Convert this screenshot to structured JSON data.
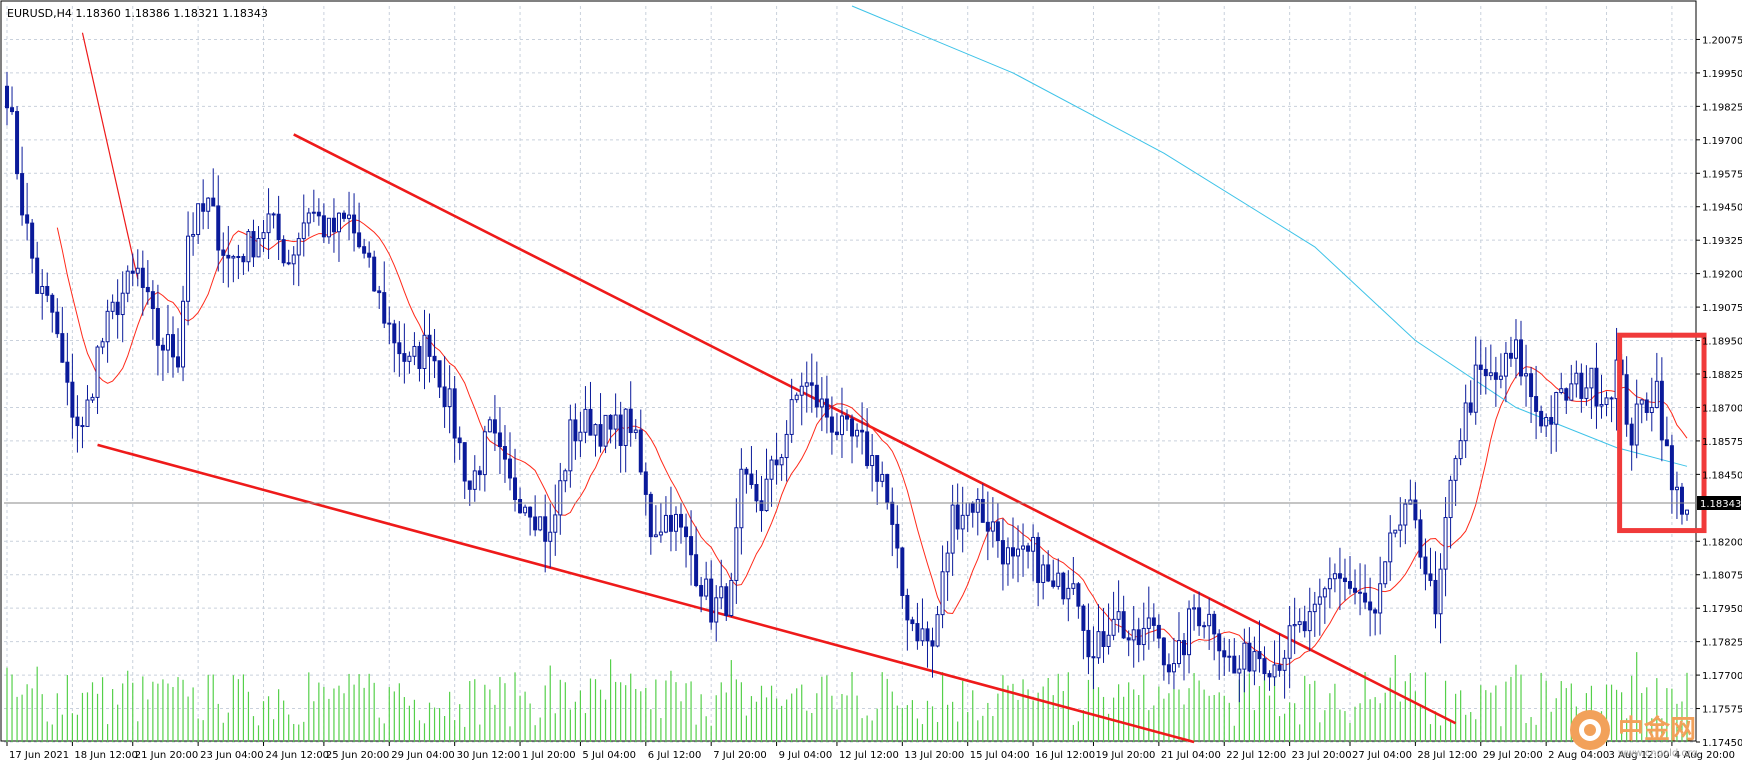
{
  "chart_data": {
    "type": "candlestick",
    "symbol_header": "EURUSD,H4  1.18360 1.18386 1.18321 1.18343",
    "current_price": 1.18343,
    "current_price_label": "1.18343",
    "ylim": [
      1.1745,
      1.202
    ],
    "y_ticks": [
      {
        "v": 1.20075,
        "label": "1.20075"
      },
      {
        "v": 1.1995,
        "label": "1.19950"
      },
      {
        "v": 1.19825,
        "label": "1.19825"
      },
      {
        "v": 1.197,
        "label": "1.19700"
      },
      {
        "v": 1.19575,
        "label": "1.19575"
      },
      {
        "v": 1.1945,
        "label": "1.19450"
      },
      {
        "v": 1.19325,
        "label": "1.19325"
      },
      {
        "v": 1.192,
        "label": "1.19200"
      },
      {
        "v": 1.19075,
        "label": "1.19075"
      },
      {
        "v": 1.1895,
        "label": "1.18950"
      },
      {
        "v": 1.18825,
        "label": "1.18825"
      },
      {
        "v": 1.187,
        "label": "1.18700"
      },
      {
        "v": 1.18575,
        "label": "1.18575"
      },
      {
        "v": 1.1845,
        "label": "1.18450"
      },
      {
        "v": 1.182,
        "label": "1.18200"
      },
      {
        "v": 1.18075,
        "label": "1.18075"
      },
      {
        "v": 1.1795,
        "label": "1.17950"
      },
      {
        "v": 1.17825,
        "label": "1.17825"
      },
      {
        "v": 1.177,
        "label": "1.17700"
      },
      {
        "v": 1.17575,
        "label": "1.17575"
      },
      {
        "v": 1.1745,
        "label": "1.17450"
      }
    ],
    "x_ticks": [
      {
        "i": 0,
        "label": "17 Jun 2021"
      },
      {
        "i": 13,
        "label": "18 Jun 12:00"
      },
      {
        "i": 25,
        "label": "21 Jun 20:00"
      },
      {
        "i": 38,
        "label": "23 Jun 04:00"
      },
      {
        "i": 51,
        "label": "24 Jun 12:00"
      },
      {
        "i": 63,
        "label": "25 Jun 20:00"
      },
      {
        "i": 76,
        "label": "29 Jun 04:00"
      },
      {
        "i": 89,
        "label": "30 Jun 12:00"
      },
      {
        "i": 102,
        "label": "1 Jul 20:00"
      },
      {
        "i": 114,
        "label": "5 Jul 04:00"
      },
      {
        "i": 127,
        "label": "6 Jul 12:00"
      },
      {
        "i": 140,
        "label": "7 Jul 20:00"
      },
      {
        "i": 153,
        "label": "9 Jul 04:00"
      },
      {
        "i": 165,
        "label": "12 Jul 12:00"
      },
      {
        "i": 178,
        "label": "13 Jul 20:00"
      },
      {
        "i": 191,
        "label": "15 Jul 04:00"
      },
      {
        "i": 204,
        "label": "16 Jul 12:00"
      },
      {
        "i": 216,
        "label": "19 Jul 20:00"
      },
      {
        "i": 229,
        "label": "21 Jul 04:00"
      },
      {
        "i": 242,
        "label": "22 Jul 12:00"
      },
      {
        "i": 255,
        "label": "23 Jul 20:00"
      },
      {
        "i": 267,
        "label": "27 Jul 04:00"
      },
      {
        "i": 280,
        "label": "28 Jul 12:00"
      },
      {
        "i": 293,
        "label": "29 Jul 20:00"
      },
      {
        "i": 306,
        "label": "2 Aug 04:00"
      },
      {
        "i": 318,
        "label": "3 Aug 12:00"
      },
      {
        "i": 331,
        "label": "4 Aug 20:00"
      }
    ],
    "bar_count": 335,
    "anchors": [
      [
        0,
        1.1989
      ],
      [
        3,
        1.1946
      ],
      [
        6,
        1.1915
      ],
      [
        9,
        1.1905
      ],
      [
        12,
        1.1875
      ],
      [
        15,
        1.186
      ],
      [
        18,
        1.189
      ],
      [
        22,
        1.191
      ],
      [
        26,
        1.192
      ],
      [
        30,
        1.1895
      ],
      [
        34,
        1.189
      ],
      [
        36,
        1.1935
      ],
      [
        40,
        1.1945
      ],
      [
        44,
        1.1925
      ],
      [
        48,
        1.193
      ],
      [
        52,
        1.194
      ],
      [
        56,
        1.1925
      ],
      [
        60,
        1.1945
      ],
      [
        64,
        1.1935
      ],
      [
        68,
        1.194
      ],
      [
        72,
        1.192
      ],
      [
        76,
        1.19
      ],
      [
        80,
        1.1885
      ],
      [
        84,
        1.1895
      ],
      [
        88,
        1.187
      ],
      [
        92,
        1.184
      ],
      [
        96,
        1.186
      ],
      [
        100,
        1.184
      ],
      [
        104,
        1.1835
      ],
      [
        108,
        1.182
      ],
      [
        112,
        1.186
      ],
      [
        116,
        1.1865
      ],
      [
        120,
        1.186
      ],
      [
        124,
        1.1865
      ],
      [
        128,
        1.1825
      ],
      [
        132,
        1.183
      ],
      [
        136,
        1.1815
      ],
      [
        140,
        1.1795
      ],
      [
        144,
        1.18
      ],
      [
        146,
        1.184
      ],
      [
        150,
        1.1835
      ],
      [
        154,
        1.1855
      ],
      [
        158,
        1.188
      ],
      [
        162,
        1.187
      ],
      [
        166,
        1.186
      ],
      [
        170,
        1.1855
      ],
      [
        174,
        1.1845
      ],
      [
        178,
        1.18
      ],
      [
        180,
        1.179
      ],
      [
        184,
        1.178
      ],
      [
        188,
        1.183
      ],
      [
        192,
        1.1835
      ],
      [
        196,
        1.1825
      ],
      [
        200,
        1.181
      ],
      [
        204,
        1.1815
      ],
      [
        208,
        1.18
      ],
      [
        212,
        1.181
      ],
      [
        216,
        1.1775
      ],
      [
        220,
        1.1795
      ],
      [
        224,
        1.178
      ],
      [
        228,
        1.179
      ],
      [
        232,
        1.177
      ],
      [
        236,
        1.1795
      ],
      [
        240,
        1.179
      ],
      [
        244,
        1.177
      ],
      [
        248,
        1.178
      ],
      [
        252,
        1.1775
      ],
      [
        256,
        1.1785
      ],
      [
        260,
        1.179
      ],
      [
        264,
        1.181
      ],
      [
        268,
        1.18
      ],
      [
        272,
        1.179
      ],
      [
        276,
        1.1825
      ],
      [
        280,
        1.183
      ],
      [
        284,
        1.179
      ],
      [
        288,
        1.1855
      ],
      [
        292,
        1.188
      ],
      [
        296,
        1.188
      ],
      [
        300,
        1.189
      ],
      [
        304,
        1.187
      ],
      [
        306,
        1.1865
      ],
      [
        310,
        1.1875
      ],
      [
        314,
        1.188
      ],
      [
        318,
        1.1875
      ],
      [
        320,
        1.1885
      ],
      [
        323,
        1.186
      ],
      [
        325,
        1.187
      ],
      [
        328,
        1.1878
      ],
      [
        331,
        1.1838
      ],
      [
        334,
        1.1834
      ]
    ],
    "ma_slow_points": [
      [
        168,
        1.202
      ],
      [
        200,
        1.1995
      ],
      [
        230,
        1.1965
      ],
      [
        260,
        1.193
      ],
      [
        280,
        1.1895
      ],
      [
        300,
        1.187
      ],
      [
        320,
        1.1855
      ],
      [
        334,
        1.1848
      ]
    ],
    "trendlines": [
      {
        "name": "upper-channel",
        "from": [
          57,
          1.1972
        ],
        "to": [
          288,
          1.1752
        ]
      },
      {
        "name": "lower-channel",
        "from": [
          18,
          1.1856
        ],
        "to": [
          236,
          1.1745
        ]
      },
      {
        "name": "steep-decline",
        "from": [
          15,
          1.201
        ],
        "to": [
          26,
          1.1918
        ]
      }
    ],
    "highlight_box": {
      "from_bar": 321,
      "to_bar": 335,
      "y_top": 1.1897,
      "y_bottom": 1.1824
    },
    "colors": {
      "candle": "#0a1a9a",
      "ma_fast": "#ff2a1a",
      "ma_slow": "#3ec3e8",
      "trendline": "#ee1a1a",
      "volume": "#55d04a",
      "grid": "#c9d1dc",
      "box": "#f03a3a"
    },
    "watermark": {
      "brand": "中金网",
      "url": "www.cngold.org"
    }
  }
}
